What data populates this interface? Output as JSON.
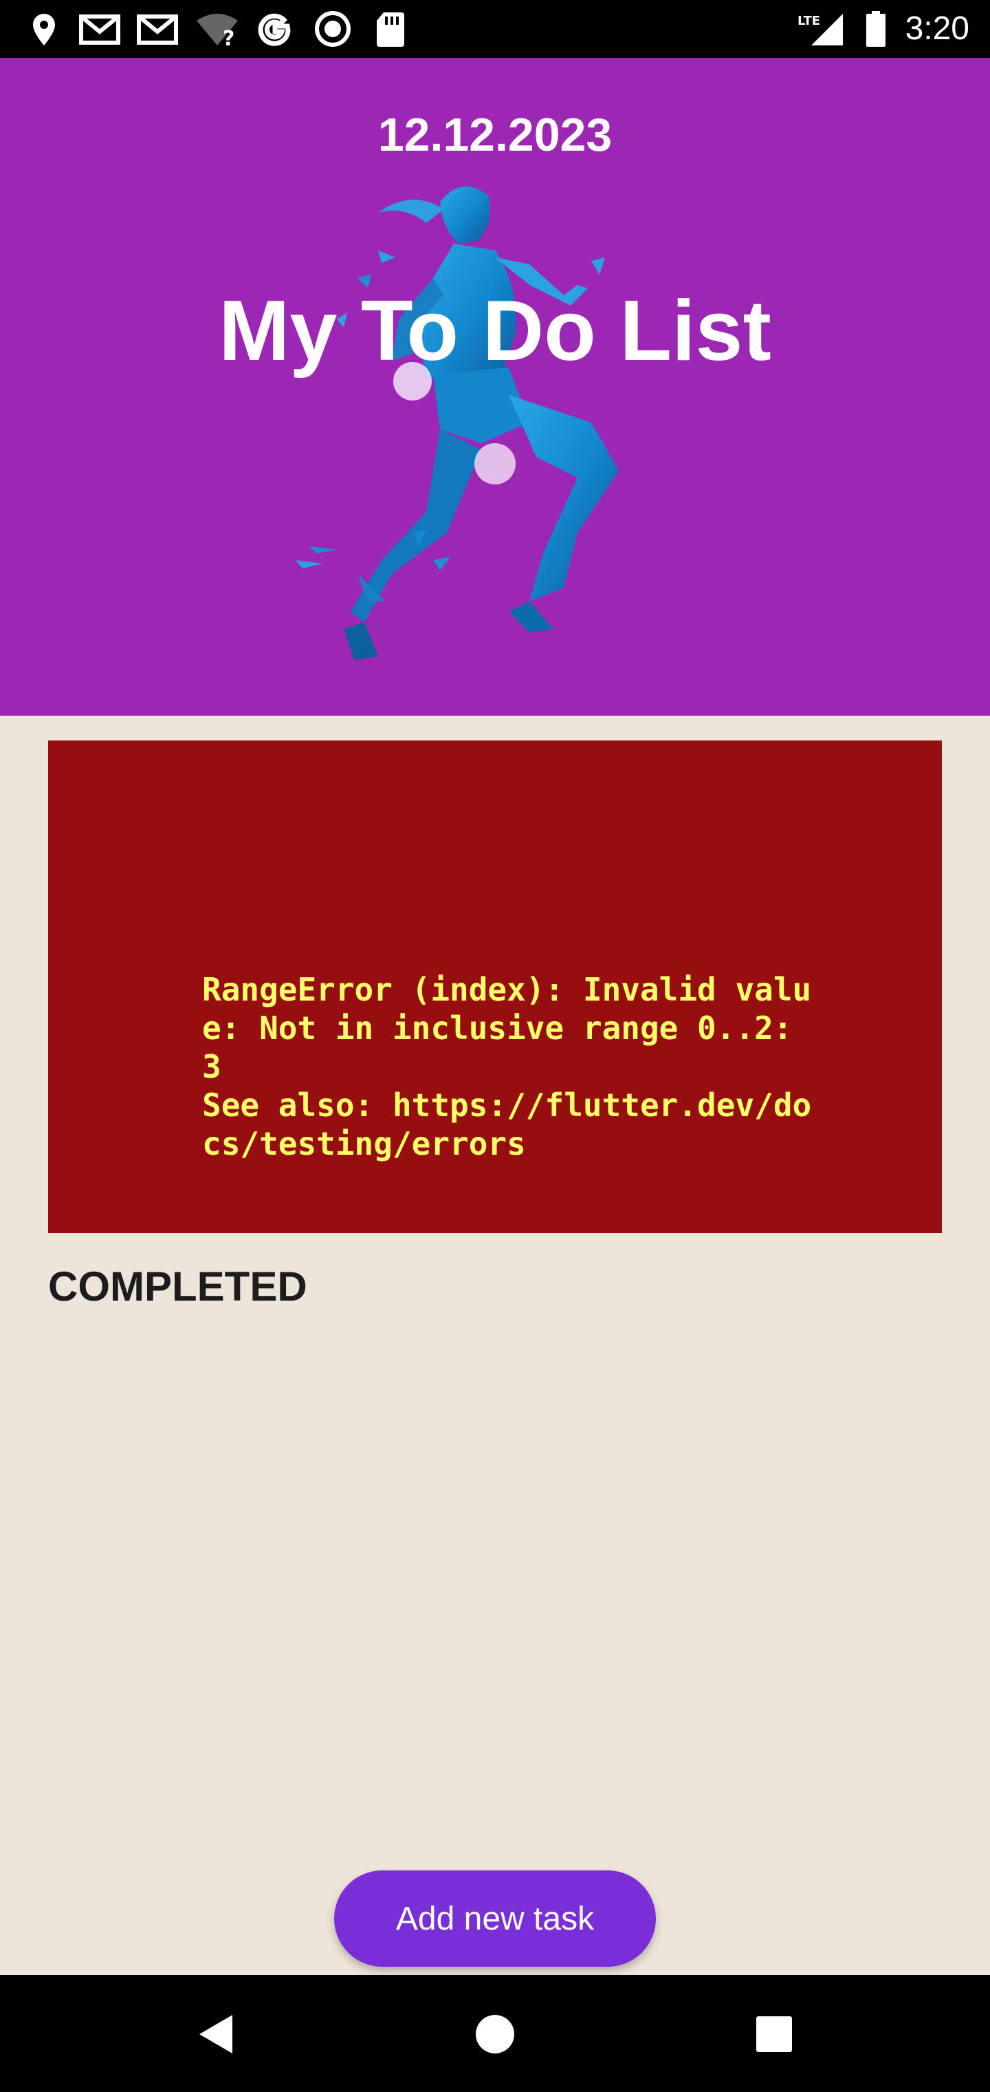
{
  "status_bar": {
    "time": "3:20",
    "icons_left": [
      "location-icon",
      "gmail-icon",
      "gmail-icon",
      "wifi-unknown-icon",
      "google-icon",
      "record-icon",
      "sd-card-icon"
    ],
    "icons_right": [
      "lte-signal-icon",
      "battery-icon"
    ],
    "network_label": "LTE"
  },
  "header": {
    "date": "12.12.2023",
    "title": "My To Do List",
    "background_color": "#9b27b4",
    "image": "running-woman-illustration"
  },
  "error": {
    "message": "RangeError (index): Invalid value: Not in inclusive range 0..2: 3\nSee also: https://flutter.dev/docs/testing/errors",
    "background_color": "#960f10",
    "text_color": "#ffff6a"
  },
  "completed_section": {
    "heading": "COMPLETED"
  },
  "actions": {
    "add_task_label": "Add new task",
    "button_color": "#7a2ed8"
  },
  "nav_bar": {
    "buttons": [
      "back-icon",
      "home-icon",
      "recents-icon"
    ]
  }
}
